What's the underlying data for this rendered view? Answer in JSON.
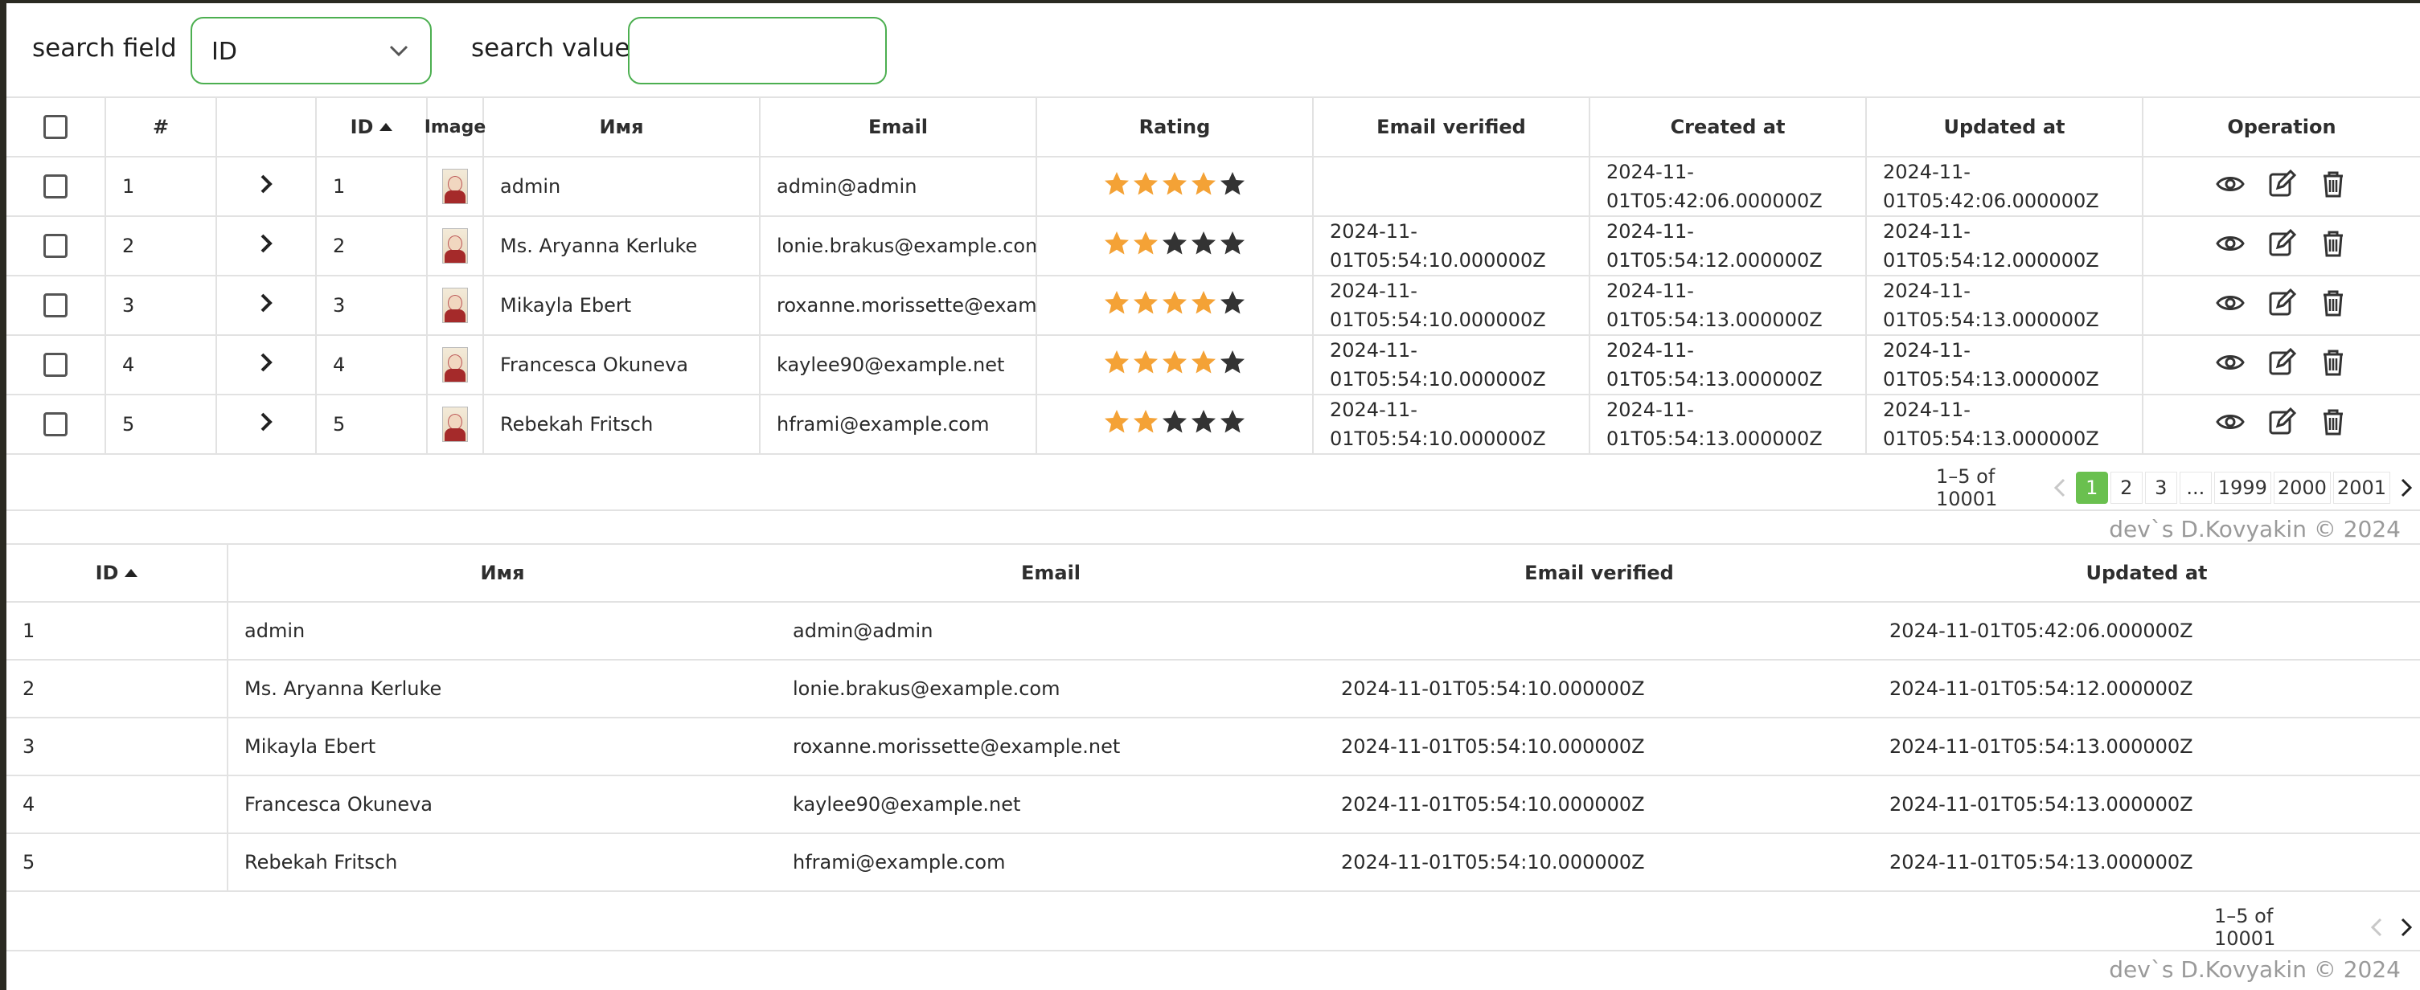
{
  "search": {
    "field_label": "search field",
    "field_value": "ID",
    "value_label": "search value:",
    "value": ""
  },
  "grid1": {
    "headers": [
      "#",
      "",
      "ID",
      "Image",
      "Имя",
      "Email",
      "Rating",
      "Email verified",
      "Created at",
      "Updated at",
      "Operation"
    ],
    "rows": [
      {
        "num": "1",
        "id": "1",
        "name": "admin",
        "email": "admin@admin",
        "rating": 4,
        "verified": "",
        "created": "2024-11-01T05:42:06.000000Z",
        "updated": "2024-11-01T05:42:06.000000Z"
      },
      {
        "num": "2",
        "id": "2",
        "name": "Ms. Aryanna Kerluke",
        "email": "lonie.brakus@example.com",
        "rating": 2,
        "verified": "2024-11-01T05:54:10.000000Z",
        "created": "2024-11-01T05:54:12.000000Z",
        "updated": "2024-11-01T05:54:12.000000Z"
      },
      {
        "num": "3",
        "id": "3",
        "name": "Mikayla Ebert",
        "email": "roxanne.morissette@example.",
        "rating": 4,
        "verified": "2024-11-01T05:54:10.000000Z",
        "created": "2024-11-01T05:54:13.000000Z",
        "updated": "2024-11-01T05:54:13.000000Z"
      },
      {
        "num": "4",
        "id": "4",
        "name": "Francesca Okuneva",
        "email": "kaylee90@example.net",
        "rating": 4,
        "verified": "2024-11-01T05:54:10.000000Z",
        "created": "2024-11-01T05:54:13.000000Z",
        "updated": "2024-11-01T05:54:13.000000Z"
      },
      {
        "num": "5",
        "id": "5",
        "name": "Rebekah Fritsch",
        "email": "hframi@example.com",
        "rating": 2,
        "verified": "2024-11-01T05:54:10.000000Z",
        "created": "2024-11-01T05:54:13.000000Z",
        "updated": "2024-11-01T05:54:13.000000Z"
      }
    ],
    "pagination": {
      "range": "1–5 of 10001",
      "pages": [
        "1",
        "2",
        "3",
        "...",
        "1999",
        "2000",
        "2001"
      ],
      "active": "1"
    }
  },
  "grid2": {
    "headers": [
      "ID",
      "Имя",
      "Email",
      "Email verified",
      "Updated at"
    ],
    "rows": [
      {
        "id": "1",
        "name": "admin",
        "email": "admin@admin",
        "verified": "",
        "updated": "2024-11-01T05:42:06.000000Z"
      },
      {
        "id": "2",
        "name": "Ms. Aryanna Kerluke",
        "email": "lonie.brakus@example.com",
        "verified": "2024-11-01T05:54:10.000000Z",
        "updated": "2024-11-01T05:54:12.000000Z"
      },
      {
        "id": "3",
        "name": "Mikayla Ebert",
        "email": "roxanne.morissette@example.net",
        "verified": "2024-11-01T05:54:10.000000Z",
        "updated": "2024-11-01T05:54:13.000000Z"
      },
      {
        "id": "4",
        "name": "Francesca Okuneva",
        "email": "kaylee90@example.net",
        "verified": "2024-11-01T05:54:10.000000Z",
        "updated": "2024-11-01T05:54:13.000000Z"
      },
      {
        "id": "5",
        "name": "Rebekah Fritsch",
        "email": "hframi@example.com",
        "verified": "2024-11-01T05:54:10.000000Z",
        "updated": "2024-11-01T05:54:13.000000Z"
      }
    ],
    "pagination": {
      "range": "1–5 of 10001"
    }
  },
  "footer": "dev`s D.Kovyakin © 2024",
  "colors": {
    "accent": "#4caf50",
    "page_active": "#6ac04f",
    "star_filled": "#f4a236",
    "star_empty": "#333333"
  },
  "icons": {
    "view": "eye-icon",
    "edit": "edit-icon",
    "delete": "trash-icon",
    "expand": "chevron-right-icon",
    "sort": "sort-asc-icon"
  }
}
